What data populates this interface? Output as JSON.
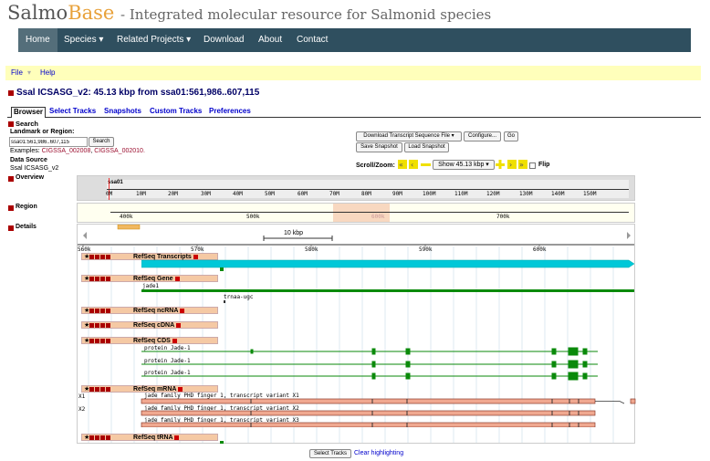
{
  "header": {
    "logo_a": "Salmo",
    "logo_b": "Base",
    "subtitle": "- Integrated molecular resource for Salmonid species"
  },
  "nav": {
    "home": "Home",
    "species": "Species ▾",
    "projects": "Related Projects ▾",
    "download": "Download",
    "about": "About",
    "contact": "Contact"
  },
  "menubar": {
    "file": "File",
    "help": "Help"
  },
  "title": "Ssal ICSASG_v2: 45.13 kbp from ssa01:561,986..607,115",
  "tabs": {
    "browser": "Browser",
    "select": "Select Tracks",
    "snapshots": "Snapshots",
    "custom": "Custom Tracks",
    "prefs": "Preferences"
  },
  "search": {
    "section": "Search",
    "landmark_label": "Landmark or Region:",
    "value": "ssa01:561,986..607,115",
    "button": "Search",
    "examples_label": "Examples:",
    "ex1": "CIGSSA_002008",
    "ex2": "CIGSSA_002010.",
    "ds_label": "Data Source",
    "ds_value": "Ssal ICSASG_v2"
  },
  "tools": {
    "download_select": "Download Transcript Sequence File ▾",
    "configure": "Configure...",
    "go": "Go",
    "save": "Save Snapshot",
    "load": "Load Snapshot",
    "scroll_label": "Scroll/Zoom:",
    "zoom_select": "Show 45.13 kbp ▾",
    "flip": "Flip"
  },
  "overview": {
    "label": "Overview",
    "chrom": "ssa01",
    "ticks": [
      "0M",
      "10M",
      "20M",
      "30M",
      "40M",
      "50M",
      "60M",
      "70M",
      "80M",
      "90M",
      "100M",
      "110M",
      "120M",
      "130M",
      "140M",
      "150M"
    ]
  },
  "region": {
    "label": "Region",
    "ticks": [
      "400k",
      "500k",
      "600k",
      "700k"
    ]
  },
  "details": {
    "label": "Details",
    "scale": "10 kbp",
    "ticks": [
      "560k",
      "570k",
      "580k",
      "590k",
      "600k"
    ]
  },
  "tracks": {
    "transcripts": "RefSeq Transcripts",
    "gene": "RefSeq Gene",
    "gene_jade": "jade1",
    "gene_trna": "trnaa-ugc",
    "ncrna": "RefSeq ncRNA",
    "cdna": "RefSeq cDNA",
    "cds": "RefSeq CDS",
    "cds_protein": "protein Jade-1",
    "mrna": "RefSeq mRNA",
    "mrna1": "jade family PHD finger 1, transcript variant X1",
    "mrna2": "jade family PHD finger 1, transcript variant X2",
    "mrna3": "jade family PHD finger 1, transcript variant X3",
    "x1": "X1",
    "x2": "X2",
    "trna": "RefSeq tRNA"
  },
  "footer": {
    "select": "Select Tracks",
    "clear": "Clear highlighting"
  },
  "colors": {
    "nav": "#2f4f5f",
    "transcripts": "#00c8d8",
    "gene": "#0a8a0a",
    "mrna": "#f0a890"
  }
}
